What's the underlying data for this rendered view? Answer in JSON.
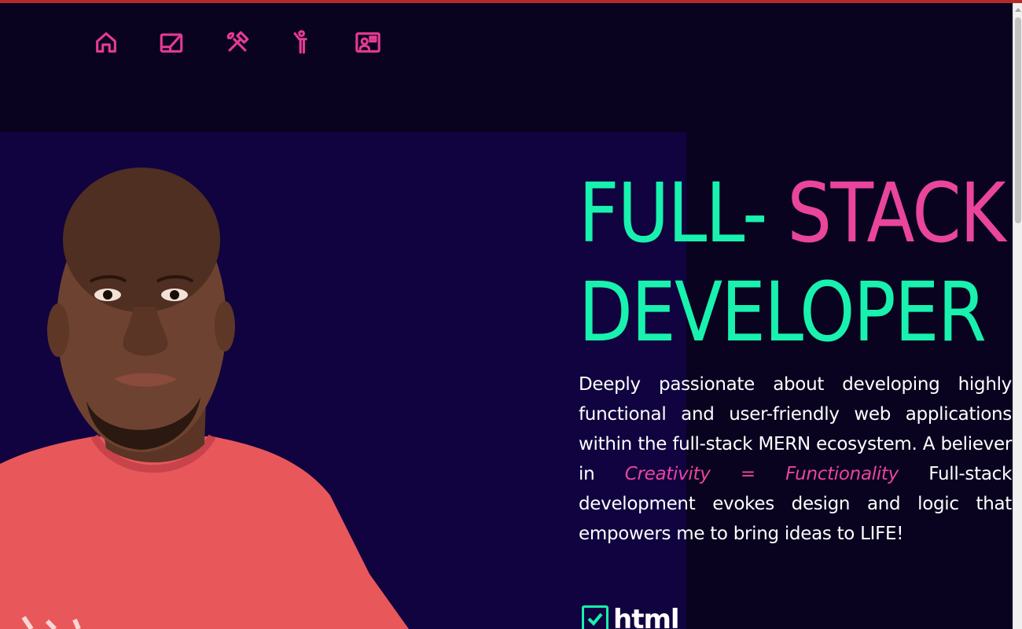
{
  "nav": {
    "items": [
      {
        "icon": "home-icon"
      },
      {
        "icon": "projects-icon"
      },
      {
        "icon": "tools-icon"
      },
      {
        "icon": "about-person-icon"
      },
      {
        "icon": "contact-card-icon"
      }
    ],
    "accent_color": "#e53a93"
  },
  "hero": {
    "headline_part1": "FULL- ",
    "headline_part2": "STACK",
    "headline_line2": "DEVELOPER",
    "bio_before": "Deeply passionate about developing highly functional and user-friendly web applications within the full-stack MERN ecosystem. A believer in ",
    "bio_emphasis": "Creativity = Functionality",
    "bio_after": " Full-stack development evokes design and logic that empowers me to bring ideas to LIFE!",
    "colors": {
      "green": "#18f2ae",
      "pink": "#e9459c",
      "panel": "#10033f",
      "background": "#09031f"
    }
  },
  "skills": {
    "first_label": "html",
    "check_icon": "checkbox-icon"
  }
}
